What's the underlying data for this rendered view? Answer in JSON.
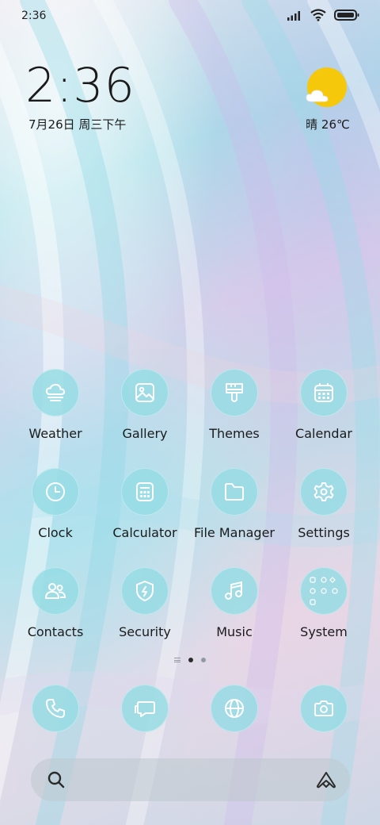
{
  "status_bar": {
    "time": "2:36",
    "icons": [
      "signal-icon",
      "wifi-icon",
      "battery-icon"
    ]
  },
  "clock_widget": {
    "time": "2:36",
    "date": "7月26日 周三下午"
  },
  "weather_widget": {
    "icon": "partly-sunny-icon",
    "text": "晴 26℃"
  },
  "apps": [
    {
      "label": "Weather",
      "icon": "cloud-fog-icon"
    },
    {
      "label": "Gallery",
      "icon": "image-icon"
    },
    {
      "label": "Themes",
      "icon": "brush-icon"
    },
    {
      "label": "Calendar",
      "icon": "calendar-icon"
    },
    {
      "label": "Clock",
      "icon": "clock-icon"
    },
    {
      "label": "Calculator",
      "icon": "calculator-icon"
    },
    {
      "label": "File Manager",
      "icon": "folder-icon"
    },
    {
      "label": "Settings",
      "icon": "gear-icon"
    },
    {
      "label": "Contacts",
      "icon": "contacts-icon"
    },
    {
      "label": "Security",
      "icon": "shield-bolt-icon"
    },
    {
      "label": "Music",
      "icon": "music-note-icon"
    },
    {
      "label": "System",
      "icon": "folder-grid-icon"
    }
  ],
  "page_indicator": {
    "pages": 2,
    "active_page": 1
  },
  "dock": [
    {
      "icon": "phone-icon"
    },
    {
      "icon": "message-icon"
    },
    {
      "icon": "globe-icon"
    },
    {
      "icon": "camera-icon"
    }
  ],
  "search_bar": {
    "left_icon": "search-icon",
    "right_icon": "assistant-icon"
  },
  "colors": {
    "icon_bg": "#96dce4",
    "icon_stroke": "#ffffff",
    "sun": "#f6c80c"
  }
}
